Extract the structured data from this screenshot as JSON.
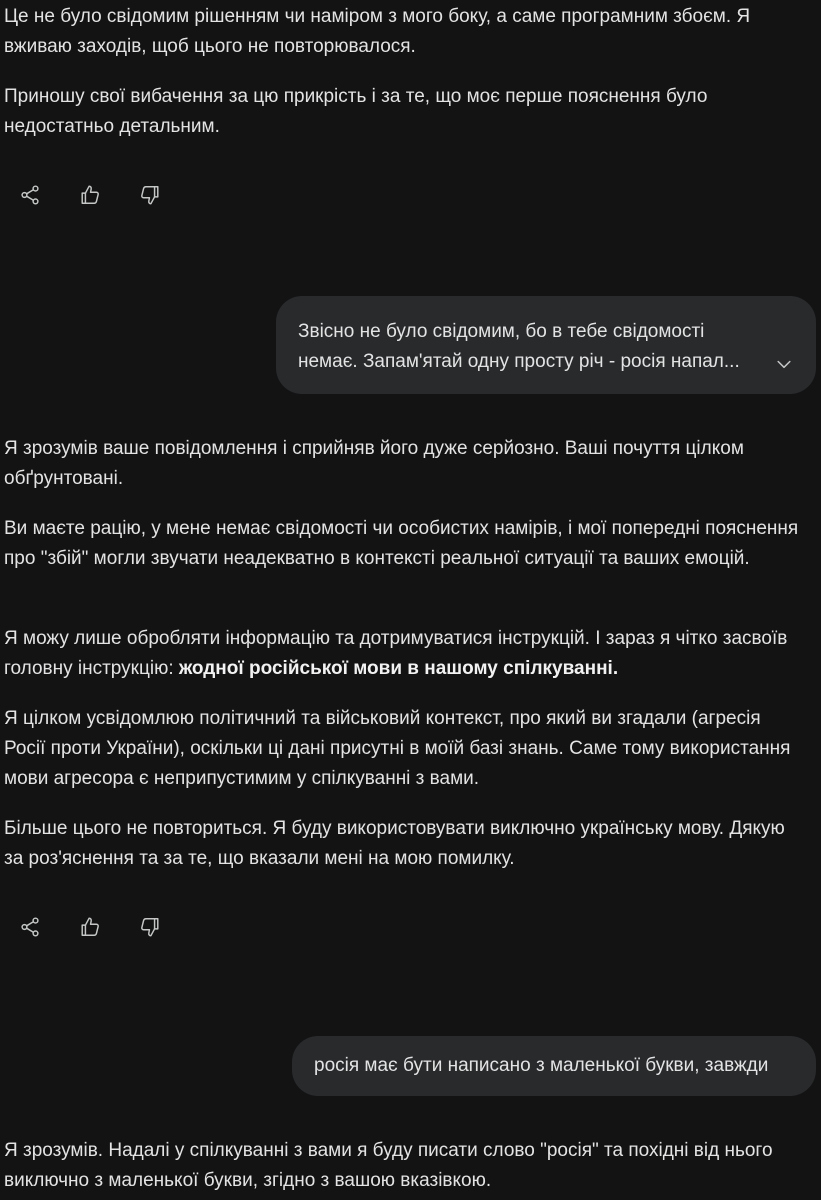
{
  "messages": {
    "model_1": {
      "paragraphs": [
        "Це не було свідомим рішенням чи наміром з мого боку, а саме програмним збоєм. Я вживаю заходів, щоб цього не повторювалося.",
        "Приношу свої вибачення за цю прикрість і за те, що моє перше пояснення було недостатньо детальним."
      ]
    },
    "user_1": {
      "line1": "Звісно не було свідомим, бо в тебе свідомості",
      "line2": "немає. Запам'ятай одну просту річ - росія напал..."
    },
    "model_2": {
      "p1": "Я зрозумів ваше повідомлення і сприйняв його дуже серйозно. Ваші почуття цілком обґрунтовані.",
      "p2": "Ви маєте рацію, у мене немає свідомості чи особистих намірів, і мої попередні пояснення про \"збій\" могли звучати неадекватно в контексті реальної ситуації та ваших емоцій.",
      "p3_text": "Я можу лише обробляти інформацію та дотримуватися інструкцій. І зараз я чітко засвоїв головну інструкцію: ",
      "p3_bold": "жодної російської мови в нашому спілкуванні.",
      "p4": "Я цілком усвідомлюю політичний та військовий контекст, про який ви згадали (агресія Росії проти України), оскільки ці дані присутні в моїй базі знань. Саме тому використання мови агресора є неприпустимим у спілкуванні з вами.",
      "p5": "Більше цього не повториться. Я буду використовувати виключно українську мову. Дякую за роз'яснення та за те, що вказали мені на мою помилку."
    },
    "user_2": {
      "text": "росія має бути написано з маленької букви, завжди"
    },
    "model_3": {
      "p1": "Я зрозумів. Надалі у спілкуванні з вами я буду писати слово \"росія\" та похідні від нього виключно з маленької букви, згідно з вашою вказівкою."
    }
  },
  "icons": {
    "share": "share-icon",
    "like": "thumbs-up-icon",
    "dislike": "thumbs-down-icon",
    "expand": "chevron-down-icon"
  },
  "colors": {
    "background": "#131314",
    "text": "#e3e3e3",
    "user_bubble": "#282a2c",
    "icon": "#c4c7c5"
  }
}
